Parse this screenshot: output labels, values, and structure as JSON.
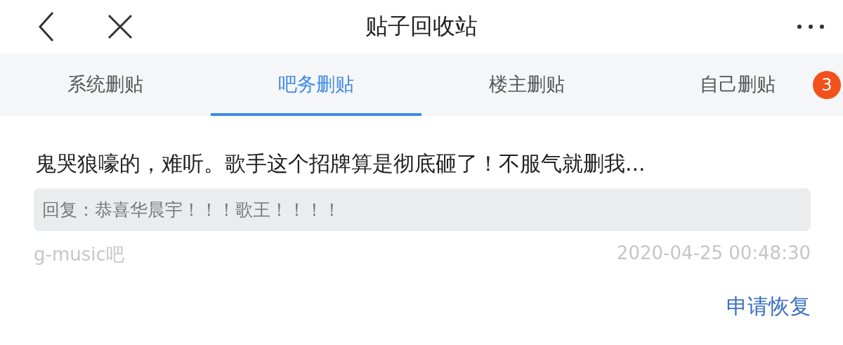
{
  "header": {
    "title": "贴子回收站"
  },
  "tabs": [
    {
      "label": "系统删贴",
      "selected": false
    },
    {
      "label": "吧务删贴",
      "selected": true
    },
    {
      "label": "楼主删贴",
      "selected": false
    },
    {
      "label": "自己删贴",
      "selected": false
    }
  ],
  "badge": "3",
  "post": {
    "title": "鬼哭狼嚎的，难听。歌手这个招牌算是彻底砸了！不服气就删我...",
    "reply": "回复：恭喜华晨宇！！！歌王！！！！",
    "forum": "g-music吧",
    "time": "2020-04-25 00:48:30",
    "action": "申请恢复"
  }
}
